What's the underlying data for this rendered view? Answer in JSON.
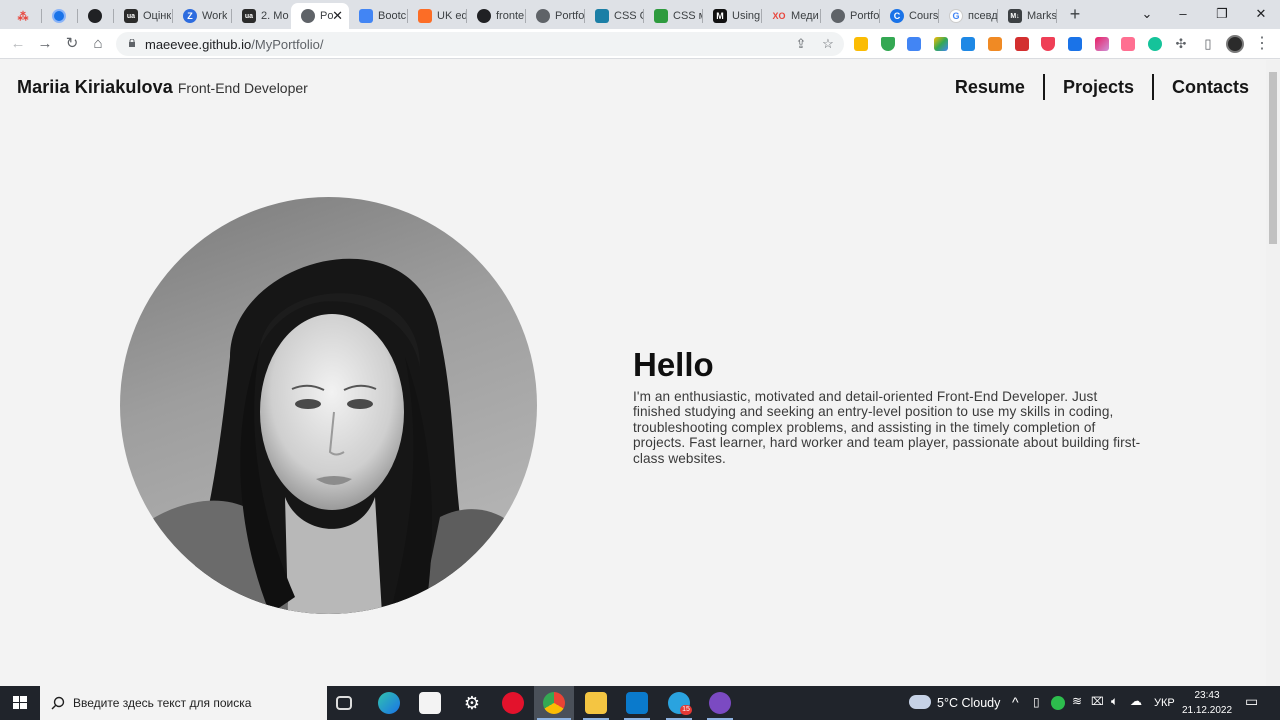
{
  "browser": {
    "tabs": [
      {
        "label": "",
        "favicon": "red-dots"
      },
      {
        "label": "",
        "favicon": "blue-circle"
      },
      {
        "label": "",
        "favicon": "github-icon"
      },
      {
        "label": "Оцінк",
        "favicon": "ukr-icon"
      },
      {
        "label": "Work",
        "favicon": "z-icon"
      },
      {
        "label": "2. Мо",
        "favicon": "ukr-icon"
      },
      {
        "label": "Po",
        "favicon": "globe-icon",
        "active": true
      },
      {
        "label": "Bootc",
        "favicon": "docs-icon"
      },
      {
        "label": "UK ed",
        "favicon": "gitlab-icon"
      },
      {
        "label": "fronte",
        "favicon": "github-icon"
      },
      {
        "label": "Portfo",
        "favicon": "globe-icon"
      },
      {
        "label": "CSS C",
        "favicon": "css-icon"
      },
      {
        "label": "CSS м",
        "favicon": "leaf-icon"
      },
      {
        "label": "Using",
        "favicon": "m-icon"
      },
      {
        "label": "Меди",
        "favicon": "xo-icon"
      },
      {
        "label": "Portfo",
        "favicon": "globe-icon"
      },
      {
        "label": "Cours",
        "favicon": "c-icon"
      },
      {
        "label": "псевд",
        "favicon": "google-icon"
      },
      {
        "label": "Marks",
        "favicon": "md-icon"
      }
    ],
    "url_host": "maeevee.github.io",
    "url_path": "/MyPortfolio/"
  },
  "site": {
    "brand_name": "Mariia Kiriakulova",
    "brand_role": "Front-End Developer",
    "nav": [
      "Resume",
      "Projects",
      "Contacts"
    ],
    "hero_title": "Hello",
    "hero_body": "I'm an enthusiastic, motivated and detail-oriented Front-End Developer. Just finished studying and seeking an entry-level position to use my skills in coding, troubleshooting complex problems, and assisting in the timely completion of projects. Fast learner, hard worker and team player, passionate about building first-class websites."
  },
  "taskbar": {
    "search_placeholder": "Введите здесь текст для поиска",
    "weather": "5°C  Cloudy",
    "language": "УКР",
    "time": "23:43",
    "date": "21.12.2022",
    "badge": "15"
  },
  "colors": {
    "tabstrip": "#dee1e6",
    "page_bg": "#f3f3f3",
    "taskbar": "#20242b"
  }
}
